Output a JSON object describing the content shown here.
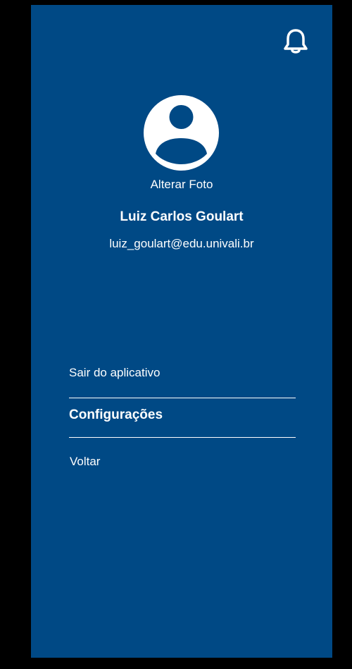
{
  "header": {
    "notification_icon": "bell-icon"
  },
  "profile": {
    "avatar_icon": "user-avatar-icon",
    "change_photo_label": "Alterar Foto",
    "name": "Luiz Carlos Goulart",
    "email": "luiz_goulart@edu.univali.br"
  },
  "menu": {
    "items": [
      {
        "label": "Sair do aplicativo"
      },
      {
        "label": "Configurações"
      },
      {
        "label": "Voltar"
      }
    ]
  },
  "colors": {
    "background": "#004985",
    "foreground": "#ffffff",
    "frame": "#000000"
  }
}
